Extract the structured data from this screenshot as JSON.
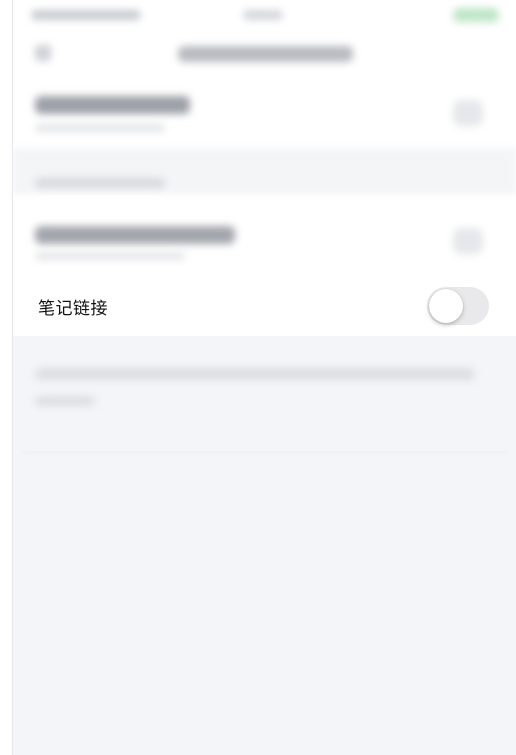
{
  "settings": {
    "note_link_label": "笔记链接",
    "note_link_enabled": false
  },
  "colors": {
    "screen_background": "#f4f5f8",
    "toggle_off": "#e9e9eb",
    "status_green": "#bfe6c7"
  }
}
